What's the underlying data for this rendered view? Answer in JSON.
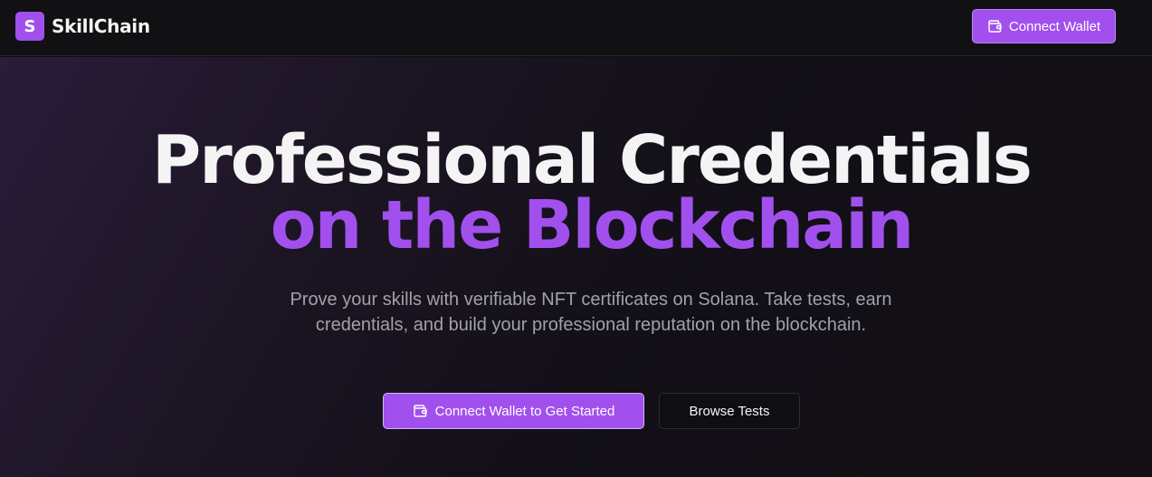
{
  "header": {
    "logo_letter": "S",
    "brand_name": "SkillChain",
    "connect_wallet_label": "Connect Wallet",
    "wallet_icon": "wallet-icon"
  },
  "hero": {
    "headline_line1": "Professional Credentials",
    "headline_line2": "on the Blockchain",
    "subtitle": "Prove your skills with verifiable NFT certificates on Solana. Take tests, earn credentials, and build your professional reputation on the blockchain.",
    "primary_cta_label": "Connect Wallet to Get Started",
    "secondary_cta_label": "Browse Tests"
  },
  "colors": {
    "accent": "#a150ee",
    "background": "#0e0d10",
    "muted_text": "#a1a1aa"
  }
}
